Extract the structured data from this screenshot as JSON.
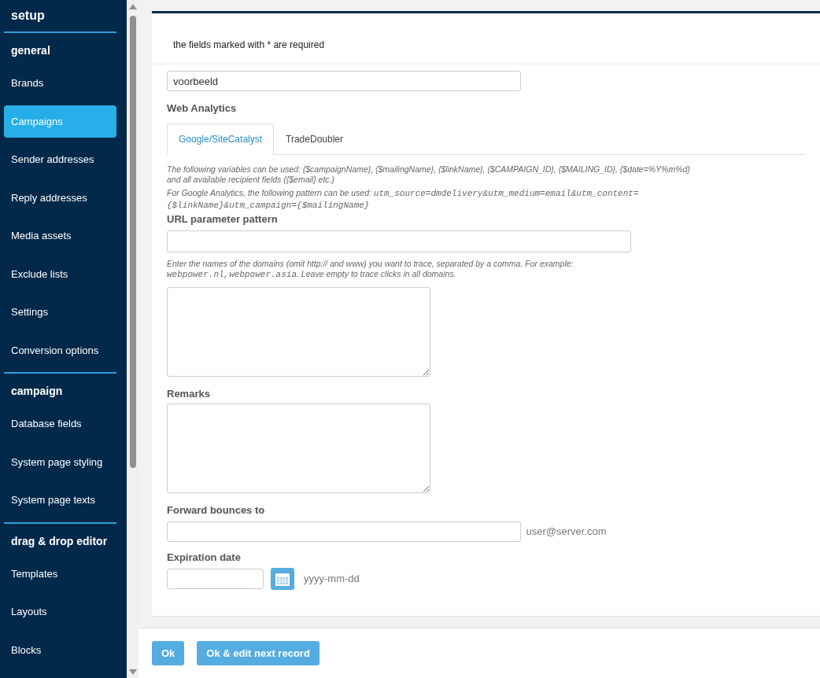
{
  "sidebar": {
    "title": "setup",
    "sections": [
      {
        "title": "general",
        "items": [
          {
            "label": "Brands",
            "selected": false
          },
          {
            "label": "Campaigns",
            "selected": true
          },
          {
            "label": "Sender addresses",
            "selected": false
          },
          {
            "label": "Reply addresses",
            "selected": false
          },
          {
            "label": "Media assets",
            "selected": false
          },
          {
            "label": "Exclude lists",
            "selected": false
          },
          {
            "label": "Settings",
            "selected": false
          },
          {
            "label": "Conversion options",
            "selected": false
          }
        ]
      },
      {
        "title": "campaign",
        "items": [
          {
            "label": "Database fields",
            "selected": false
          },
          {
            "label": "System page styling",
            "selected": false
          },
          {
            "label": "System page texts",
            "selected": false
          }
        ]
      },
      {
        "title": "drag & drop editor",
        "items": [
          {
            "label": "Templates",
            "selected": false
          },
          {
            "label": "Layouts",
            "selected": false
          },
          {
            "label": "Blocks",
            "selected": false
          }
        ]
      }
    ]
  },
  "form": {
    "required_note": "the fields marked with * are required",
    "name_field": {
      "value": "voorbeeld"
    },
    "web_analytics": {
      "label": "Web Analytics",
      "tabs": [
        {
          "label": "Google/SiteCatalyst",
          "selected": true
        },
        {
          "label": "TradeDoubler",
          "selected": false
        }
      ],
      "hints": [
        {
          "parts": [
            {
              "kind": "text",
              "text": "The following variables can be used: {$campaignName}, {$mailingName}, {$linkName}, {$CAMPAIGN_ID}, {$MAILING_ID}, {$date=%Y%m%d} and all available recipient fields ({$email} etc.)"
            }
          ]
        },
        {
          "parts": [
            {
              "kind": "text",
              "text": "For Google Analytics, the following pattern can be used: "
            },
            {
              "kind": "code",
              "text": "utm_source=dmdelivery&utm_medium=email&utm_content={$linkName}&utm_campaign={$mailingName}"
            }
          ]
        }
      ],
      "url_pattern": {
        "label": "URL parameter pattern"
      },
      "domains_hint": {
        "parts": [
          {
            "kind": "text",
            "text": "Enter the names of the domains (omit http:// and www) you want to trace, separated by a comma. For example: "
          },
          {
            "kind": "code",
            "text": "webpower.nl,webpower.asia"
          },
          {
            "kind": "text",
            "text": ". Leave empty to trace clicks in all domains."
          }
        ]
      }
    },
    "remarks": {
      "label": "Remarks"
    },
    "forward_bounces": {
      "label": "Forward bounces to",
      "hint": "user@server.com"
    },
    "expiration_date": {
      "label": "Expiration date",
      "hint": "yyyy-mm-dd"
    }
  },
  "buttons": [
    "Ok",
    "Ok & edit next record"
  ]
}
